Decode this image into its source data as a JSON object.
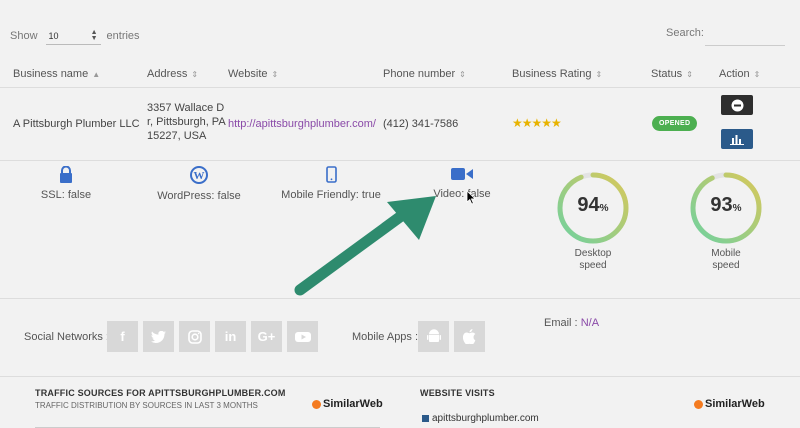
{
  "controls": {
    "show_label": "Show",
    "entries_value": "10",
    "entries_label": "entries",
    "search_label": "Search:"
  },
  "table": {
    "headers": [
      "Business name",
      "Address",
      "Website",
      "Phone number",
      "Business Rating",
      "Status",
      "Action"
    ],
    "row": {
      "business_name": "A Pittsburgh Plumber LLC",
      "address_line1": "3357 Wallace D",
      "address_line2": "r, Pittsburgh, PA",
      "address_line3": "15227, USA",
      "website": "http://apittsburghplumber.com/",
      "phone": "(412) 341-7586",
      "rating": 5,
      "stars": "★★★★★",
      "status": "OPENED"
    }
  },
  "features": {
    "ssl": "SSL: false",
    "wordpress": "WordPress: false",
    "mobile_friendly": "Mobile Friendly: true",
    "video": "Video: false"
  },
  "gauges": {
    "desktop": {
      "value": 94,
      "unit": "%",
      "label_line1": "Desktop",
      "label_line2": "speed"
    },
    "mobile": {
      "value": 93,
      "unit": "%",
      "label_line1": "Mobile",
      "label_line2": "speed"
    }
  },
  "social": {
    "label": "Social Networks :",
    "icons": [
      "facebook-icon",
      "twitter-icon",
      "instagram-icon",
      "linkedin-icon",
      "google-plus-icon",
      "youtube-icon"
    ],
    "glyphs": {
      "facebook": "f",
      "linkedin": "in",
      "google_plus": "G+"
    }
  },
  "apps": {
    "label": "Mobile Apps :",
    "icons": [
      "android-icon",
      "apple-icon"
    ]
  },
  "email": {
    "label": "Email :",
    "value": "N/A"
  },
  "traffic_panel": {
    "title": "TRAFFIC SOURCES FOR APITTSBURGHPLUMBER.COM",
    "subtitle": "TRAFFIC DISTRIBUTION BY SOURCES IN LAST 3 MONTHS",
    "brand": "SimilarWeb"
  },
  "visits_panel": {
    "title": "WEBSITE VISITS",
    "domain": "apittsburghplumber.com",
    "brand": "SimilarWeb"
  },
  "colors": {
    "accent_purple": "#8a4aa8",
    "status_green": "#4caf50",
    "annotation_arrow": "#2e8b6e",
    "icon_blue": "#3a6ec9"
  }
}
